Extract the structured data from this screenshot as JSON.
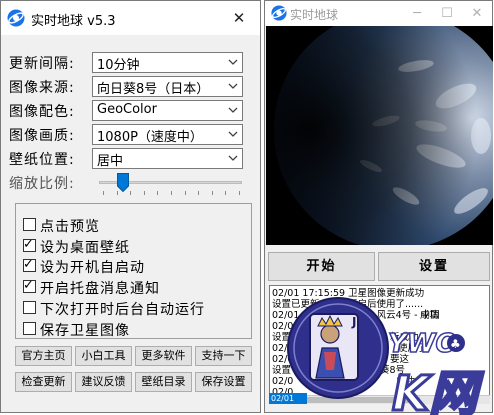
{
  "main_window": {
    "title": "实时地球 v5.3",
    "close_glyph": "✕",
    "settings": {
      "update_interval": {
        "label": "更新间隔:",
        "value": "10分钟"
      },
      "image_source": {
        "label": "图像来源:",
        "value": "向日葵8号（日本）"
      },
      "image_color": {
        "label": "图像配色:",
        "value": "GeoColor"
      },
      "image_quality": {
        "label": "图像画质:",
        "value": "1080P（速度中）"
      },
      "wallpaper_position": {
        "label": "壁纸位置:",
        "value": "居中"
      },
      "zoom_ratio": {
        "label": "缩放比例:",
        "level_fraction": 0.17
      }
    },
    "options": [
      {
        "label": "点击预览",
        "checked": false
      },
      {
        "label": "设为桌面壁纸",
        "checked": true
      },
      {
        "label": "设为开机自启动",
        "checked": true
      },
      {
        "label": "开启托盘消息通知",
        "checked": true
      },
      {
        "label": "下次打开时后台自动运行",
        "checked": false
      },
      {
        "label": "保存卫星图像",
        "checked": false
      }
    ],
    "check_glyph": "✓",
    "buttons_row1": [
      "官方主页",
      "小白工具",
      "更多软件",
      "支持一下"
    ],
    "buttons_row2": [
      "检查更新",
      "建议反馈",
      "壁纸目录",
      "保存设置"
    ]
  },
  "preview_window": {
    "title": "实时地球",
    "minimize_glyph": "─",
    "maximize_glyph": "☐",
    "close_glyph": "✕",
    "start_button": "开始",
    "settings_button": "设置",
    "log_lines": [
      "02/01 17:15:59 卫星图像更新成功",
      "设置已更新，部分开启后使用了......",
      "02/01 17:15:59 卫星：风云4号 - 中国",
      "02/0",
      "设置",
      "02/0",
      "02/0",
      "设置",
      "02/0",
      "02/0"
    ],
    "log_overlay_fragments": [
      "成功",
      "新成功",
      "使用了",
      "要这",
      "葵8号",
      "成功"
    ],
    "status_text": "02/01"
  },
  "watermark": {
    "text": "YWO",
    "big_text": "K网"
  }
}
